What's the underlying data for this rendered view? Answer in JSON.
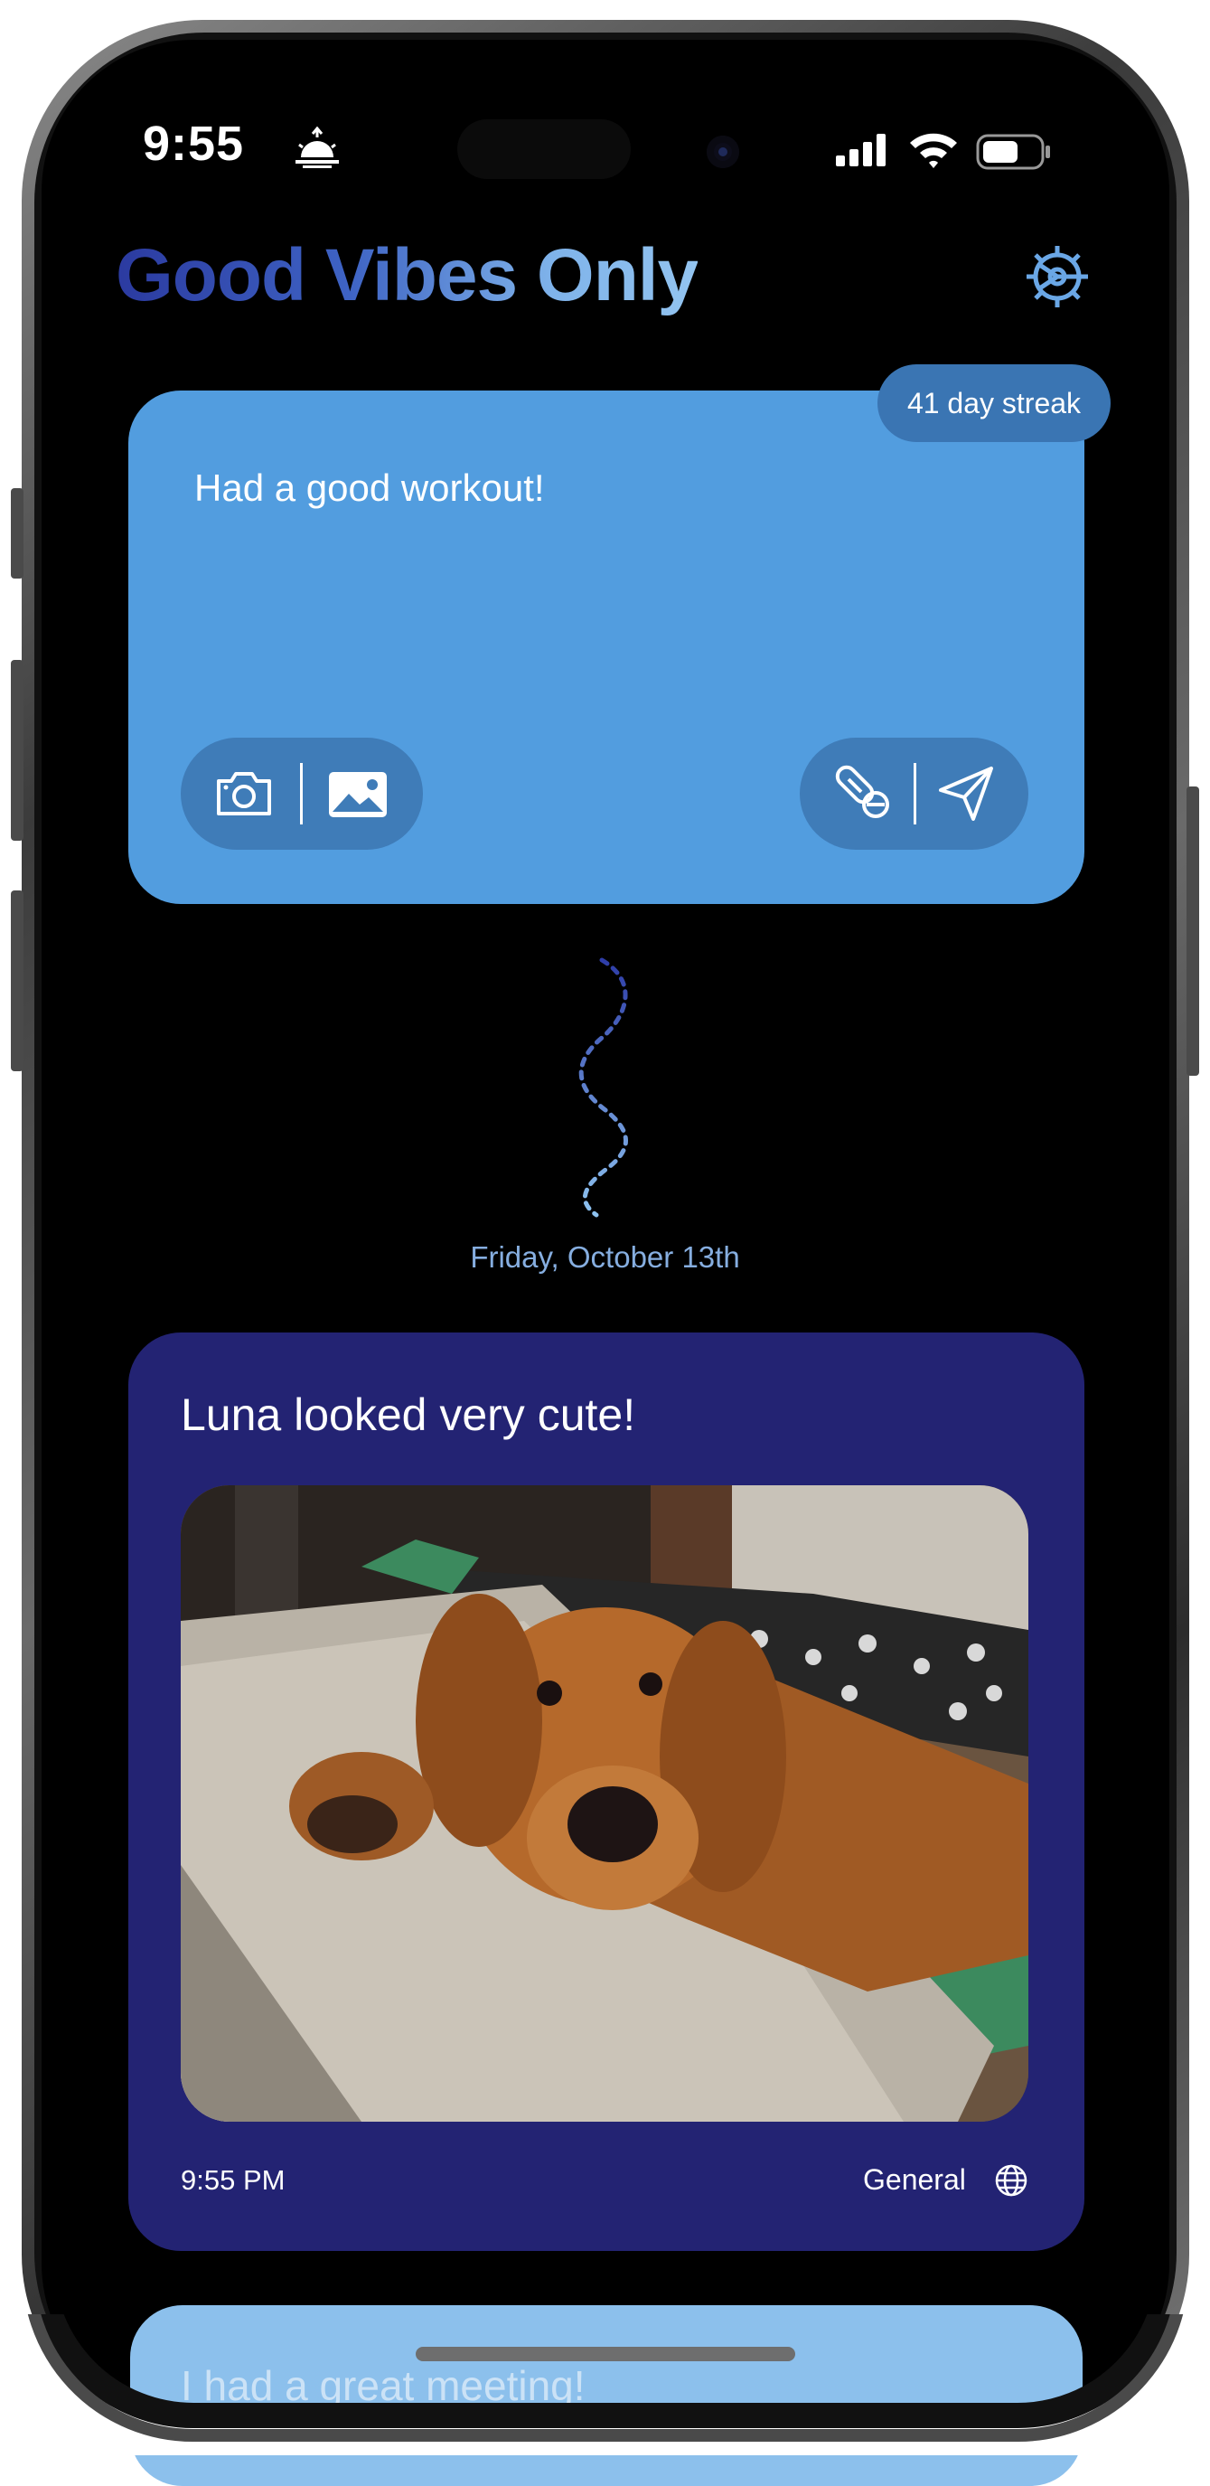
{
  "status_bar": {
    "time": "9:55"
  },
  "header": {
    "title": "Good Vibes Only"
  },
  "composer": {
    "streak_label": "41 day streak",
    "text": "Had a good workout!"
  },
  "timeline": {
    "date_label": "Friday, October 13th"
  },
  "post": {
    "title": "Luna looked very cute!",
    "time": "9:55 PM",
    "category": "General"
  },
  "next_post": {
    "title_partial": "I had a great meeting!"
  },
  "icons": {
    "sunrise": "sunrise-icon",
    "signal": "cellular-signal-icon",
    "wifi": "wifi-icon",
    "battery": "battery-icon",
    "settings": "gear-icon",
    "camera": "camera-icon",
    "gallery": "photo-gallery-icon",
    "pill": "pills-icon",
    "send": "send-icon",
    "globe": "globe-icon"
  },
  "colors": {
    "composer_bg": "#529ddf",
    "badge_bg": "#3a75b3",
    "post_bg": "#232373",
    "next_card_bg": "#8cc0ec",
    "date_label": "#86aee0"
  }
}
